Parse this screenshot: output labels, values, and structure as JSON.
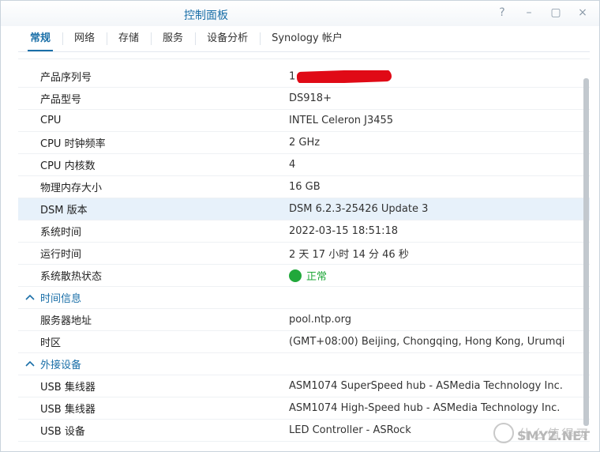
{
  "window": {
    "title": "控制面板",
    "controls": {
      "help": "?",
      "minimize": "–",
      "maximize": "▢",
      "close": "×"
    }
  },
  "tabs": [
    {
      "label": "常规",
      "active": true
    },
    {
      "label": "网络"
    },
    {
      "label": "存储"
    },
    {
      "label": "服务"
    },
    {
      "label": "设备分析"
    },
    {
      "label": "Synology 帐户"
    }
  ],
  "info": [
    {
      "label": "产品序列号",
      "value": "1"
    },
    {
      "label": "产品型号",
      "value": "DS918+"
    },
    {
      "label": "CPU",
      "value": "INTEL Celeron J3455"
    },
    {
      "label": "CPU 时钟频率",
      "value": "2 GHz"
    },
    {
      "label": "CPU 内核数",
      "value": "4"
    },
    {
      "label": "物理内存大小",
      "value": "16 GB"
    },
    {
      "label": "DSM 版本",
      "value": "DSM 6.2.3-25426 Update 3"
    },
    {
      "label": "系统时间",
      "value": "2022-03-15 18:51:18"
    },
    {
      "label": "运行时间",
      "value": "2 天 17 小时 14 分 46 秒"
    },
    {
      "label": "系统散热状态",
      "value": "正常"
    }
  ],
  "time_section": {
    "title": "时间信息",
    "rows": [
      {
        "label": "服务器地址",
        "value": "pool.ntp.org"
      },
      {
        "label": "时区",
        "value": "(GMT+08:00) Beijing, Chongqing, Hong Kong, Urumqi"
      }
    ]
  },
  "device_section": {
    "title": "外接设备",
    "rows": [
      {
        "label": "USB 集线器",
        "value": "ASM1074 SuperSpeed hub - ASMedia Technology Inc."
      },
      {
        "label": "USB 集线器",
        "value": "ASM1074 High-Speed hub - ASMedia Technology Inc."
      },
      {
        "label": "USB 设备",
        "value": "LED Controller - ASRock"
      }
    ]
  },
  "watermark": {
    "cn": "什么值得买",
    "en": "SMYZ.NET"
  },
  "colors": {
    "accent": "#1a6fa8",
    "status_ok": "#21a83b",
    "selected_row": "#e7f1fa",
    "redaction": "#e00a16"
  }
}
